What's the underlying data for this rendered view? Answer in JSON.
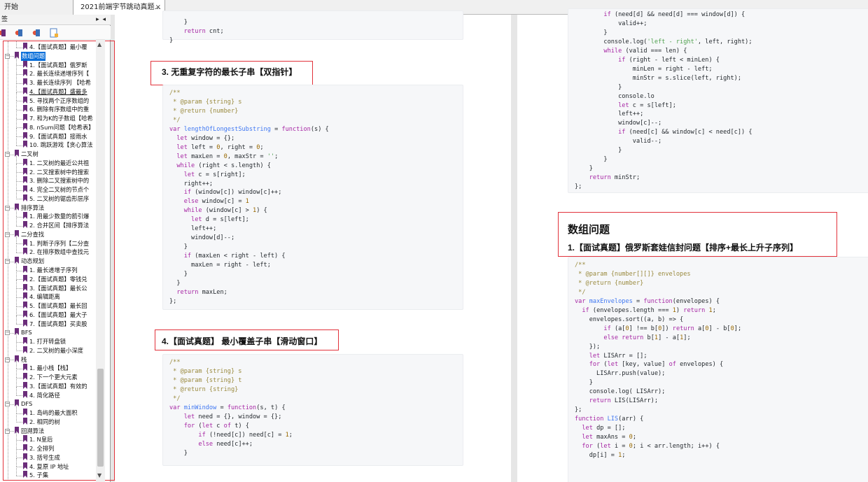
{
  "tabs": {
    "start": "开始",
    "document": "2021前端字节跳动真题...",
    "close": "×"
  },
  "sidebar": {
    "title": "签",
    "controls": "▸ ◂",
    "tools": [
      "bookmark-expand-icon",
      "bookmark-collapse-icon",
      "bookmark-find-icon",
      "bookmark-add-icon"
    ],
    "tree": [
      {
        "type": "item",
        "text": "4.【面试真题】最小覆"
      },
      {
        "type": "section",
        "text": "数组问题",
        "selected": true
      },
      {
        "type": "item",
        "text": "1.【面试真题】俄罗斯"
      },
      {
        "type": "item",
        "text": "2. 最长连续递增序列【"
      },
      {
        "type": "item",
        "text": "3. 最长连续序列 【哈希"
      },
      {
        "type": "item",
        "text": "4.【面试真题】盛最多",
        "underline": true
      },
      {
        "type": "item",
        "text": "5. 寻找两个正序数组的"
      },
      {
        "type": "item",
        "text": "6. 删除有序数组中的重"
      },
      {
        "type": "item",
        "text": "7. 和为K的子数组【哈希"
      },
      {
        "type": "item",
        "text": "8. nSum问题【哈希表】"
      },
      {
        "type": "item",
        "text": "9.【面试真题】接雨水"
      },
      {
        "type": "item",
        "text": "10. 跳跃游戏【贪心算法"
      },
      {
        "type": "section",
        "text": "二叉树"
      },
      {
        "type": "item",
        "text": "1. 二叉树的最近公共祖"
      },
      {
        "type": "item",
        "text": "2. 二叉搜索树中的搜索"
      },
      {
        "type": "item",
        "text": "3. 删除二叉搜索树中的"
      },
      {
        "type": "item",
        "text": "4. 完全二叉树的节点个"
      },
      {
        "type": "item",
        "text": "5. 二叉树的锯齿形层序"
      },
      {
        "type": "section",
        "text": "排序算法"
      },
      {
        "type": "item",
        "text": "1. 用最少数量的箭引爆"
      },
      {
        "type": "item",
        "text": "2. 合并区间【排序算法"
      },
      {
        "type": "section",
        "text": "二分查找"
      },
      {
        "type": "item",
        "text": "1. 判断子序列【二分查"
      },
      {
        "type": "item",
        "text": "2. 在排序数组中查找元"
      },
      {
        "type": "section",
        "text": "动态规划"
      },
      {
        "type": "item",
        "text": "1. 最长递增子序列"
      },
      {
        "type": "item",
        "text": "2.【面试真题】零钱兑"
      },
      {
        "type": "item",
        "text": "3.【面试真题】最长公"
      },
      {
        "type": "item",
        "text": "4. 编辑距离"
      },
      {
        "type": "item",
        "text": "5.【面试真题】最长回"
      },
      {
        "type": "item",
        "text": "6.【面试真题】最大子"
      },
      {
        "type": "item",
        "text": "7.【面试真题】买卖股"
      },
      {
        "type": "section",
        "text": "BFS"
      },
      {
        "type": "item",
        "text": "1. 打开转盘锁"
      },
      {
        "type": "item",
        "text": "2. 二叉树的最小深度"
      },
      {
        "type": "section",
        "text": "栈"
      },
      {
        "type": "item",
        "text": "1. 最小栈【栈】"
      },
      {
        "type": "item",
        "text": "2. 下一个更大元素"
      },
      {
        "type": "item",
        "text": "3.【面试真题】有效的"
      },
      {
        "type": "item",
        "text": "4. 简化路径"
      },
      {
        "type": "section",
        "text": "DFS"
      },
      {
        "type": "item",
        "text": "1. 岛屿的最大面积"
      },
      {
        "type": "item",
        "text": "2. 相同的树"
      },
      {
        "type": "section",
        "text": "回溯算法"
      },
      {
        "type": "item",
        "text": "1. N皇后"
      },
      {
        "type": "item",
        "text": "2. 全排列"
      },
      {
        "type": "item",
        "text": "3. 括号生成"
      },
      {
        "type": "item",
        "text": "4. 复原 IP 地址"
      },
      {
        "type": "item",
        "text": "5. 子集"
      }
    ]
  },
  "left_page": {
    "top_code": [
      [
        [
          "c-pl",
          "    }"
        ]
      ],
      [
        [
          "c-pl",
          "    "
        ],
        [
          "c-kw",
          "return"
        ],
        [
          "c-pl",
          " cnt;"
        ]
      ],
      [
        [
          "c-pl",
          "}"
        ]
      ]
    ],
    "heading3": "3. 无重复字符的最长子串【双指针】",
    "code3": [
      [
        [
          "c-com",
          "/**"
        ]
      ],
      [
        [
          "c-com",
          " * @param {string} s"
        ]
      ],
      [
        [
          "c-com",
          " * @return {number}"
        ]
      ],
      [
        [
          "c-com",
          " */"
        ]
      ],
      [
        [
          "c-kw",
          "var"
        ],
        [
          "c-pl",
          " "
        ],
        [
          "c-fn",
          "lengthOfLongestSubstring"
        ],
        [
          "c-pl",
          " = "
        ],
        [
          "c-kw",
          "function"
        ],
        [
          "c-pl",
          "(s) {"
        ]
      ],
      [
        [
          "c-pl",
          "  "
        ],
        [
          "c-kw",
          "let"
        ],
        [
          "c-pl",
          " window = {};"
        ]
      ],
      [
        [
          "c-pl",
          "  "
        ],
        [
          "c-kw",
          "let"
        ],
        [
          "c-pl",
          " left = "
        ],
        [
          "c-num",
          "0"
        ],
        [
          "c-pl",
          ", right = "
        ],
        [
          "c-num",
          "0"
        ],
        [
          "c-pl",
          ";"
        ]
      ],
      [
        [
          "c-pl",
          "  "
        ],
        [
          "c-kw",
          "let"
        ],
        [
          "c-pl",
          " maxLen = "
        ],
        [
          "c-num",
          "0"
        ],
        [
          "c-pl",
          ", maxStr = "
        ],
        [
          "c-str",
          "''"
        ],
        [
          "c-pl",
          ";"
        ]
      ],
      [
        [
          "c-pl",
          "  "
        ],
        [
          "c-kw",
          "while"
        ],
        [
          "c-pl",
          " (right < s.length) {"
        ]
      ],
      [
        [
          "c-pl",
          "    "
        ],
        [
          "c-kw",
          "let"
        ],
        [
          "c-pl",
          " c = s[right];"
        ]
      ],
      [
        [
          "c-pl",
          "    right++;"
        ]
      ],
      [
        [
          "c-pl",
          "    "
        ],
        [
          "c-kw",
          "if"
        ],
        [
          "c-pl",
          " (window[c]) window[c]++;"
        ]
      ],
      [
        [
          "c-pl",
          "    "
        ],
        [
          "c-kw",
          "else"
        ],
        [
          "c-pl",
          " window[c] = "
        ],
        [
          "c-num",
          "1"
        ]
      ],
      [
        [
          "c-pl",
          "    "
        ],
        [
          "c-kw",
          "while"
        ],
        [
          "c-pl",
          " (window[c] > "
        ],
        [
          "c-num",
          "1"
        ],
        [
          "c-pl",
          ") {"
        ]
      ],
      [
        [
          "c-pl",
          "      "
        ],
        [
          "c-kw",
          "let"
        ],
        [
          "c-pl",
          " d = s[left];"
        ]
      ],
      [
        [
          "c-pl",
          "      left++;"
        ]
      ],
      [
        [
          "c-pl",
          "      window[d]--;"
        ]
      ],
      [
        [
          "c-pl",
          "    }"
        ]
      ],
      [
        [
          "c-pl",
          "    "
        ],
        [
          "c-kw",
          "if"
        ],
        [
          "c-pl",
          " (maxLen < right - left) {"
        ]
      ],
      [
        [
          "c-pl",
          "      maxLen = right - left;"
        ]
      ],
      [
        [
          "c-pl",
          "    }"
        ]
      ],
      [
        [
          "c-pl",
          "  }"
        ]
      ],
      [
        [
          "c-pl",
          "  "
        ],
        [
          "c-kw",
          "return"
        ],
        [
          "c-pl",
          " maxLen;"
        ]
      ],
      [
        [
          "c-pl",
          "};"
        ]
      ]
    ],
    "heading4": "4.【面试真题】 最小覆盖子串【滑动窗口】",
    "code4": [
      [
        [
          "c-com",
          "/**"
        ]
      ],
      [
        [
          "c-com",
          " * @param {string} s"
        ]
      ],
      [
        [
          "c-com",
          " * @param {string} t"
        ]
      ],
      [
        [
          "c-com",
          " * @return {string}"
        ]
      ],
      [
        [
          "c-com",
          " */"
        ]
      ],
      [
        [
          "c-kw",
          "var"
        ],
        [
          "c-pl",
          " "
        ],
        [
          "c-fn",
          "minWindow"
        ],
        [
          "c-pl",
          " = "
        ],
        [
          "c-kw",
          "function"
        ],
        [
          "c-pl",
          "(s, t) {"
        ]
      ],
      [
        [
          "c-pl",
          "    "
        ],
        [
          "c-kw",
          "let"
        ],
        [
          "c-pl",
          " need = {}, window = {};"
        ]
      ],
      [
        [
          "c-pl",
          "    "
        ],
        [
          "c-kw",
          "for"
        ],
        [
          "c-pl",
          " ("
        ],
        [
          "c-kw",
          "let"
        ],
        [
          "c-pl",
          " c "
        ],
        [
          "c-kw",
          "of"
        ],
        [
          "c-pl",
          " t) {"
        ]
      ],
      [
        [
          "c-pl",
          "        "
        ],
        [
          "c-kw",
          "if"
        ],
        [
          "c-pl",
          " (!need[c]) need[c] = "
        ],
        [
          "c-num",
          "1"
        ],
        [
          "c-pl",
          ";"
        ]
      ],
      [
        [
          "c-pl",
          "        "
        ],
        [
          "c-kw",
          "else"
        ],
        [
          "c-pl",
          " need[c]++;"
        ]
      ],
      [
        [
          "c-pl",
          "    }"
        ]
      ]
    ]
  },
  "right_page": {
    "top_code": [
      [
        [
          "c-pl",
          "        "
        ],
        [
          "c-kw",
          "if"
        ],
        [
          "c-pl",
          " (need[d] && need[d] === window[d]) {"
        ]
      ],
      [
        [
          "c-pl",
          "            valid++;"
        ]
      ],
      [
        [
          "c-pl",
          "        }"
        ]
      ],
      [
        [
          "c-pl",
          "        console.log("
        ],
        [
          "c-str",
          "'left - right'"
        ],
        [
          "c-pl",
          ", left, right);"
        ]
      ],
      [
        [
          "c-pl",
          "        "
        ],
        [
          "c-kw",
          "while"
        ],
        [
          "c-pl",
          " (valid === len) {"
        ]
      ],
      [
        [
          "c-pl",
          "            "
        ],
        [
          "c-kw",
          "if"
        ],
        [
          "c-pl",
          " (right - left < minLen) {"
        ]
      ],
      [
        [
          "c-pl",
          "                minLen = right - left;"
        ]
      ],
      [
        [
          "c-pl",
          "                minStr = s.slice(left, right);"
        ]
      ],
      [
        [
          "c-pl",
          "            }"
        ]
      ],
      [
        [
          "c-pl",
          "            console.lo"
        ]
      ],
      [
        [
          "c-pl",
          "            "
        ],
        [
          "c-kw",
          "let"
        ],
        [
          "c-pl",
          " c = s[left];"
        ]
      ],
      [
        [
          "c-pl",
          "            left++;"
        ]
      ],
      [
        [
          "c-pl",
          "            window[c]--;"
        ]
      ],
      [
        [
          "c-pl",
          "            "
        ],
        [
          "c-kw",
          "if"
        ],
        [
          "c-pl",
          " (need[c] && window[c] < need[c]) {"
        ]
      ],
      [
        [
          "c-pl",
          "                valid--;"
        ]
      ],
      [
        [
          "c-pl",
          "            }"
        ]
      ],
      [
        [
          "c-pl",
          "        }"
        ]
      ],
      [
        [
          "c-pl",
          "    }"
        ]
      ],
      [
        [
          "c-pl",
          "    "
        ],
        [
          "c-kw",
          "return"
        ],
        [
          "c-pl",
          " minStr;"
        ]
      ],
      [
        [
          "c-pl",
          "};"
        ]
      ]
    ],
    "heading2": "数组问题",
    "heading3": "1.【面试真题】俄罗斯套娃信封问题【排序+最长上升子序列】",
    "code": [
      [
        [
          "c-com",
          "/**"
        ]
      ],
      [
        [
          "c-com",
          " * @param {number[][]} envelopes"
        ]
      ],
      [
        [
          "c-com",
          " * @return {number}"
        ]
      ],
      [
        [
          "c-com",
          " */"
        ]
      ],
      [
        [
          "c-kw",
          "var"
        ],
        [
          "c-pl",
          " "
        ],
        [
          "c-fn",
          "maxEnvelopes"
        ],
        [
          "c-pl",
          " = "
        ],
        [
          "c-kw",
          "function"
        ],
        [
          "c-pl",
          "(envelopes) {"
        ]
      ],
      [
        [
          "c-pl",
          "  "
        ],
        [
          "c-kw",
          "if"
        ],
        [
          "c-pl",
          " (envelopes.length === "
        ],
        [
          "c-num",
          "1"
        ],
        [
          "c-pl",
          ") "
        ],
        [
          "c-kw",
          "return"
        ],
        [
          "c-pl",
          " "
        ],
        [
          "c-num",
          "1"
        ],
        [
          "c-pl",
          ";"
        ]
      ],
      [
        [
          "c-pl",
          "    envelopes.sort((a, b) => {"
        ]
      ],
      [
        [
          "c-pl",
          "        "
        ],
        [
          "c-kw",
          "if"
        ],
        [
          "c-pl",
          " (a["
        ],
        [
          "c-num",
          "0"
        ],
        [
          "c-pl",
          "] !== b["
        ],
        [
          "c-num",
          "0"
        ],
        [
          "c-pl",
          "]) "
        ],
        [
          "c-kw",
          "return"
        ],
        [
          "c-pl",
          " a["
        ],
        [
          "c-num",
          "0"
        ],
        [
          "c-pl",
          "] - b["
        ],
        [
          "c-num",
          "0"
        ],
        [
          "c-pl",
          "];"
        ]
      ],
      [
        [
          "c-pl",
          "        "
        ],
        [
          "c-kw",
          "else"
        ],
        [
          "c-pl",
          " "
        ],
        [
          "c-kw",
          "return"
        ],
        [
          "c-pl",
          " b["
        ],
        [
          "c-num",
          "1"
        ],
        [
          "c-pl",
          "] - a["
        ],
        [
          "c-num",
          "1"
        ],
        [
          "c-pl",
          "];"
        ]
      ],
      [
        [
          "c-pl",
          "    });"
        ]
      ],
      [
        [
          "c-pl",
          "    "
        ],
        [
          "c-kw",
          "let"
        ],
        [
          "c-pl",
          " LISArr = [];"
        ]
      ],
      [
        [
          "c-pl",
          "    "
        ],
        [
          "c-kw",
          "for"
        ],
        [
          "c-pl",
          " ("
        ],
        [
          "c-kw",
          "let"
        ],
        [
          "c-pl",
          " [key, value] "
        ],
        [
          "c-kw",
          "of"
        ],
        [
          "c-pl",
          " envelopes) {"
        ]
      ],
      [
        [
          "c-pl",
          "      LISArr.push(value);"
        ]
      ],
      [
        [
          "c-pl",
          "    }"
        ]
      ],
      [
        [
          "c-pl",
          "    console.log( LISArr);"
        ]
      ],
      [
        [
          "c-pl",
          "    "
        ],
        [
          "c-kw",
          "return"
        ],
        [
          "c-pl",
          " LIS(LISArr);"
        ]
      ],
      [
        [
          "c-pl",
          "};"
        ]
      ],
      [
        [
          "c-kw",
          "function"
        ],
        [
          "c-pl",
          " "
        ],
        [
          "c-fn",
          "LIS"
        ],
        [
          "c-pl",
          "(arr) {"
        ]
      ],
      [
        [
          "c-pl",
          "  "
        ],
        [
          "c-kw",
          "let"
        ],
        [
          "c-pl",
          " dp = [];"
        ]
      ],
      [
        [
          "c-pl",
          "  "
        ],
        [
          "c-kw",
          "let"
        ],
        [
          "c-pl",
          " maxAns = "
        ],
        [
          "c-num",
          "0"
        ],
        [
          "c-pl",
          ";"
        ]
      ],
      [
        [
          "c-pl",
          "  "
        ],
        [
          "c-kw",
          "for"
        ],
        [
          "c-pl",
          " ("
        ],
        [
          "c-kw",
          "let"
        ],
        [
          "c-pl",
          " i = "
        ],
        [
          "c-num",
          "0"
        ],
        [
          "c-pl",
          "; i < arr.length; i++) {"
        ]
      ],
      [
        [
          "c-pl",
          "    dp[i] = "
        ],
        [
          "c-num",
          "1"
        ],
        [
          "c-pl",
          ";"
        ]
      ]
    ]
  }
}
